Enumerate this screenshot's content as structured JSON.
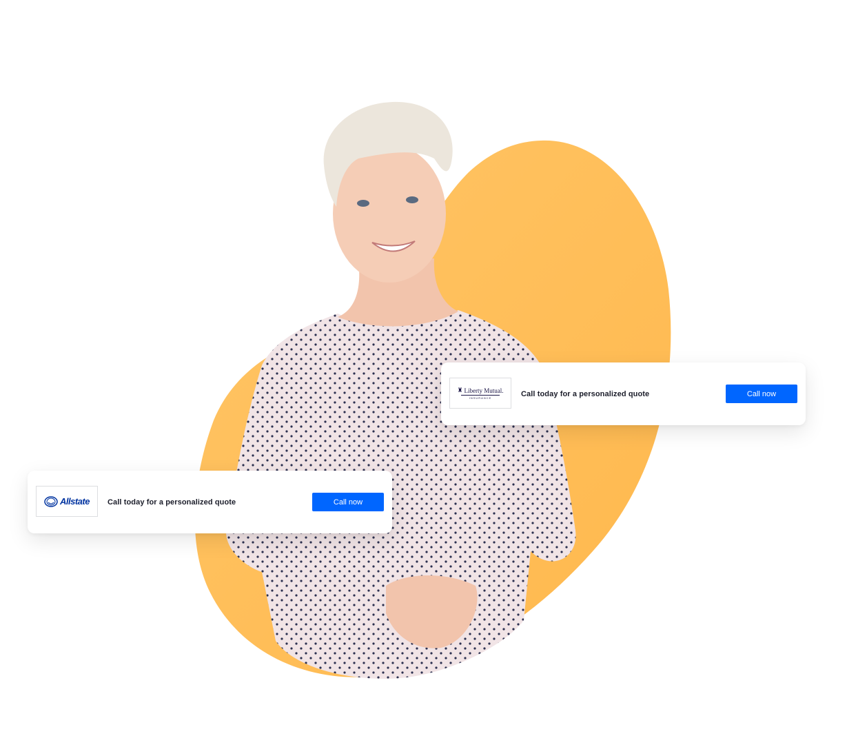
{
  "colors": {
    "blob": "#ffb84d",
    "accent": "#0066ff",
    "text": "#1b1d2a",
    "liberty_navy": "#1a1446",
    "allstate_blue": "#0033a0"
  },
  "cards": [
    {
      "brand": "Liberty Mutual.",
      "brand_sub": "INSURANCE",
      "message": "Call today for a personalized quote",
      "cta_label": "Call now"
    },
    {
      "brand": "Allstate",
      "message": "Call today for a personalized quote",
      "cta_label": "Call now"
    }
  ],
  "hero": {
    "image_alt": "Smiling woman with short platinum hair in a polka-dot top"
  }
}
